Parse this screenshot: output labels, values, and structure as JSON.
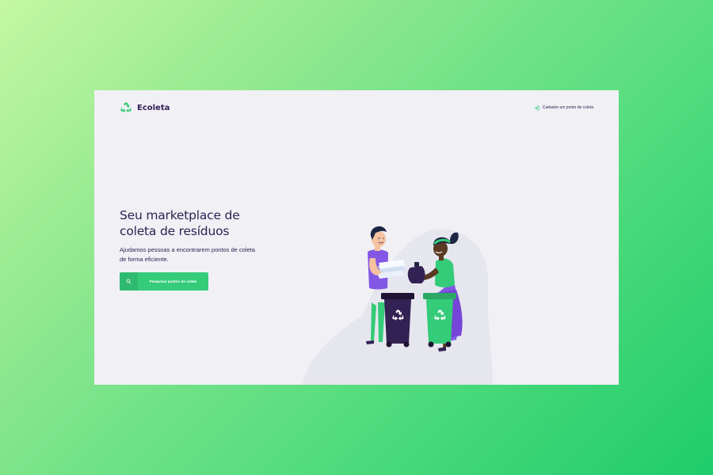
{
  "app": {
    "name": "Ecoleta"
  },
  "header": {
    "logo_icon": "recycle-icon",
    "register_icon": "log-in-icon",
    "register_label": "Cadastre um ponto de coleta"
  },
  "hero": {
    "title_line1": "Seu marketplace de",
    "title_line2": "coleta de resíduos",
    "description": "Ajudamos pessoas a encontrarem pontos de coleta de forma eficiente."
  },
  "search_button": {
    "icon": "search-icon",
    "label": "Pesquisar pontos de coleta"
  },
  "colors": {
    "primary": "#34cb79",
    "title": "#322153",
    "background": "#f0f0f5",
    "dark_bin": "#322153",
    "green_bin": "#34cb79"
  }
}
